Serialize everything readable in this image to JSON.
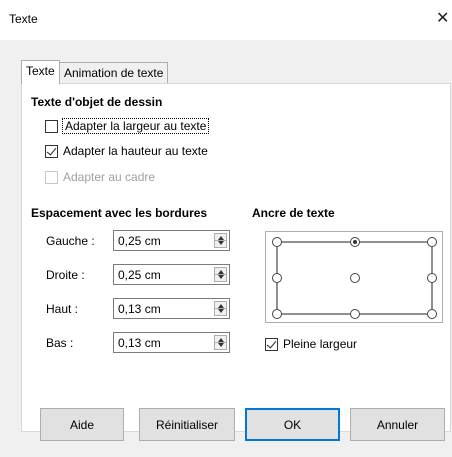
{
  "window": {
    "title": "Texte",
    "close_glyph": "✕"
  },
  "tabs": [
    {
      "label": "Texte",
      "active": true
    },
    {
      "label": "Animation de texte",
      "active": false
    }
  ],
  "drawing_text": {
    "heading": "Texte d'objet de dessin",
    "options": [
      {
        "label": "Adapter la largeur au texte",
        "checked": false,
        "disabled": false
      },
      {
        "label": "Adapter la hauteur au texte",
        "checked": true,
        "disabled": false
      },
      {
        "label": "Adapter au cadre",
        "checked": false,
        "disabled": true
      }
    ]
  },
  "spacing": {
    "heading": "Espacement avec les bordures",
    "fields": [
      {
        "label": "Gauche :",
        "value": "0,25 cm"
      },
      {
        "label": "Droite :",
        "value": "0,25 cm"
      },
      {
        "label": "Haut :",
        "value": "0,13 cm"
      },
      {
        "label": "Bas :",
        "value": "0,13 cm"
      }
    ]
  },
  "anchor": {
    "heading": "Ancre de texte",
    "selected": "top-center",
    "full_width": {
      "label": "Pleine largeur",
      "checked": true
    }
  },
  "buttons": {
    "help": "Aide",
    "reset": "Réinitialiser",
    "ok": "OK",
    "cancel": "Annuler"
  },
  "colors": {
    "dialog_bg": "#f0f0f0",
    "focus_border": "#0078d7",
    "disabled_text": "#a0a0a0"
  }
}
